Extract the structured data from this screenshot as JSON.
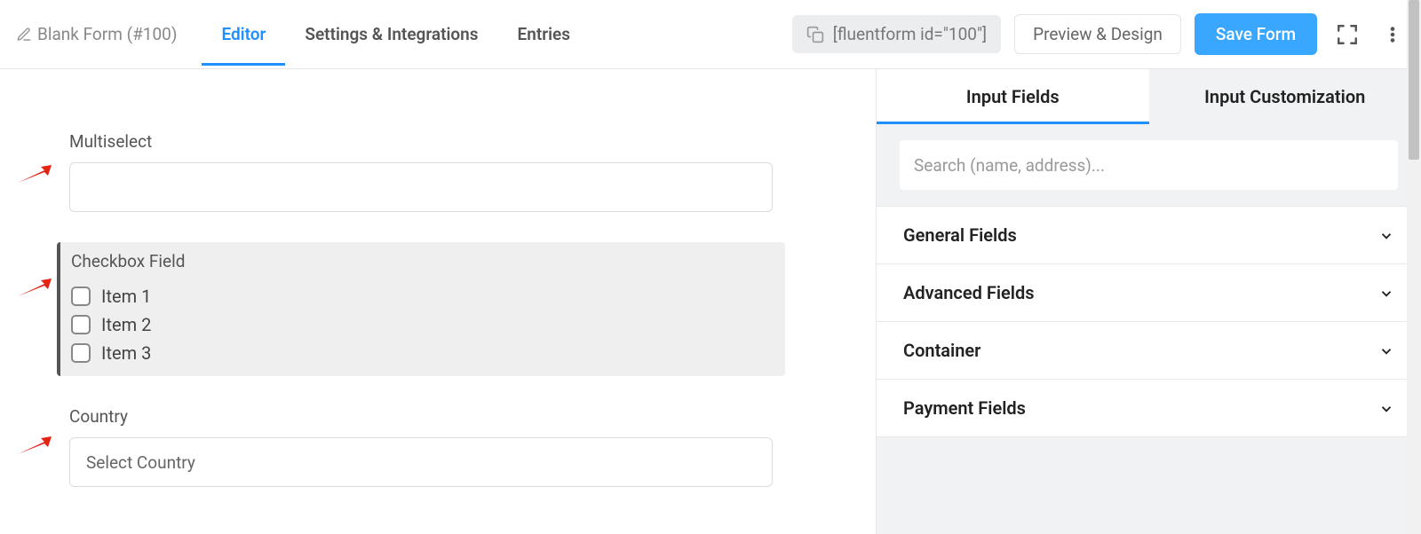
{
  "header": {
    "form_title": "Blank Form (#100)",
    "tabs": [
      {
        "label": "Editor",
        "active": true
      },
      {
        "label": "Settings & Integrations",
        "active": false
      },
      {
        "label": "Entries",
        "active": false
      }
    ],
    "shortcode": "[fluentform id=\"100\"]",
    "preview_label": "Preview & Design",
    "save_label": "Save Form"
  },
  "canvas": {
    "fields": [
      {
        "type": "multiselect",
        "label": "Multiselect",
        "value": ""
      },
      {
        "type": "checkbox",
        "label": "Checkbox Field",
        "items": [
          "Item 1",
          "Item 2",
          "Item 3"
        ],
        "selected": true
      },
      {
        "type": "country",
        "label": "Country",
        "placeholder": "Select Country"
      }
    ]
  },
  "sidebar": {
    "tabs": [
      {
        "label": "Input Fields",
        "active": true
      },
      {
        "label": "Input Customization",
        "active": false
      }
    ],
    "search_placeholder": "Search (name, address)...",
    "groups": [
      {
        "label": "General Fields"
      },
      {
        "label": "Advanced Fields"
      },
      {
        "label": "Container"
      },
      {
        "label": "Payment Fields"
      }
    ]
  }
}
